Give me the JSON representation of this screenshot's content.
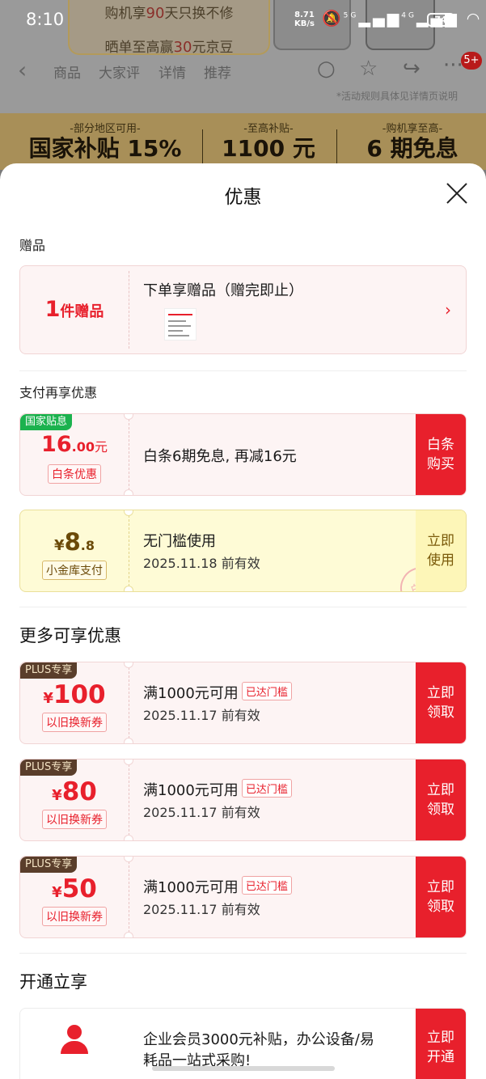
{
  "status_bar": {
    "time": "8:10",
    "net_speed": "8.71",
    "net_unit": "KB/s",
    "signal_5g": "5G",
    "signal_4g": "4G",
    "battery": "74"
  },
  "background": {
    "promo_line1_pre": "购机享",
    "promo_line1_num": "90",
    "promo_line1_post": "天只换不修",
    "promo_line2_pre": "晒单至高赢",
    "promo_line2_num": "30",
    "promo_line2_post": "元京豆",
    "nav_tabs": [
      "商品",
      "大家评",
      "详情",
      "推荐"
    ],
    "nav_badge": "5+",
    "rule_note": "*活动规则具体见详情页说明",
    "subsidy": [
      {
        "caption": "-部分地区可用-",
        "value": "国家补贴 15%"
      },
      {
        "caption": "-至高补贴-",
        "value": "1100 元"
      },
      {
        "caption": "-购机享至高-",
        "value": "6 期免息"
      }
    ]
  },
  "sheet": {
    "title": "优惠",
    "gift_section": {
      "heading": "赠品",
      "count": "1",
      "count_unit": "件赠品",
      "title": "下单享赠品（赠完即止）"
    },
    "payment_section": {
      "heading": "支付再享优惠",
      "baitiao": {
        "tag": "国家贴息",
        "amount_int": "16",
        "amount_dec": ".00",
        "amount_unit": "元",
        "chip": "白条优惠",
        "desc": "白条6期免息, 再减16元",
        "action": "白条购买"
      },
      "jinku": {
        "currency": "¥",
        "amount_int": "8",
        "amount_dec": ".8",
        "chip": "小金库支付",
        "desc": "无门槛使用",
        "valid": "2025.11.18 前有效",
        "action": "立即使用",
        "stamp": "白条"
      }
    },
    "more_section": {
      "heading": "更多可享优惠",
      "coupons": [
        {
          "tag": "PLUS专享",
          "currency": "¥",
          "amount": "100",
          "chip": "以旧换新券",
          "desc": "满1000元可用",
          "badge": "已达门槛",
          "valid": "2025.11.17 前有效",
          "action": "立即领取"
        },
        {
          "tag": "PLUS专享",
          "currency": "¥",
          "amount": "80",
          "chip": "以旧换新券",
          "desc": "满1000元可用",
          "badge": "已达门槛",
          "valid": "2025.11.17 前有效",
          "action": "立即领取"
        },
        {
          "tag": "PLUS专享",
          "currency": "¥",
          "amount": "50",
          "chip": "以旧换新券",
          "desc": "满1000元可用",
          "badge": "已达门槛",
          "valid": "2025.11.17 前有效",
          "action": "立即领取"
        }
      ]
    },
    "membership_section": {
      "heading": "开通立享",
      "desc_line1": "企业会员3000元补贴，办公设备/易",
      "desc_line2": "耗品一站式采购!",
      "action": "立即开通"
    }
  },
  "colors": {
    "accent": "#e8202c",
    "green_tag": "#1bb24e",
    "plus_tag": "#5a3e2b",
    "yellow_card": "#fefbd6"
  }
}
